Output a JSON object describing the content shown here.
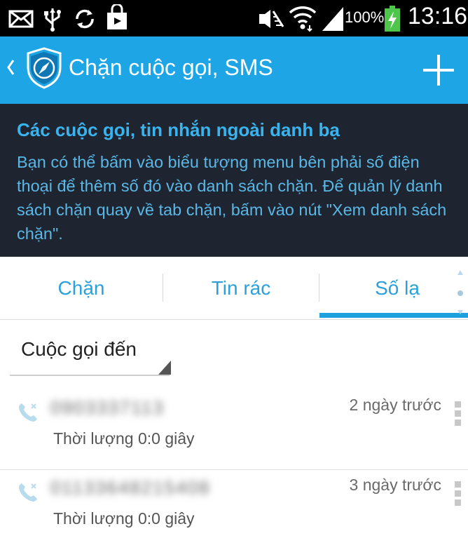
{
  "status_bar": {
    "battery": "100%",
    "clock": "13:16",
    "icons": [
      "mail-icon",
      "usb-icon",
      "sync-icon",
      "shopping-bag-icon",
      "mute-icon",
      "wifi-icon",
      "signal-icon",
      "battery-charging-icon"
    ]
  },
  "action_bar": {
    "title": "Chặn cuộc gọi, SMS",
    "add_icon": "plus-icon",
    "logo_icon": "shield-compass-icon"
  },
  "info_banner": {
    "heading": "Các cuộc gọi, tin nhắn ngoài danh bạ",
    "body": "Bạn có thể bấm vào biểu tượng menu bên phải số điện thoại để thêm số đó vào danh sách chặn. Để quản lý danh sách chặn quay về tab chặn, bấm vào nút \"Xem danh sách chặn\"."
  },
  "tabs": [
    {
      "label": "Chặn",
      "selected": false
    },
    {
      "label": "Tin rác",
      "selected": false
    },
    {
      "label": "Số lạ",
      "selected": true
    }
  ],
  "filter": {
    "selected": "Cuộc gọi đến"
  },
  "calls": [
    {
      "number": "0903337113",
      "time_ago": "2 ngày trước",
      "duration": "Thời lượng 0:0 giây",
      "icon": "missed-call-icon"
    },
    {
      "number": "01133648215408",
      "time_ago": "3 ngày trước",
      "duration": "Thời lượng 0:0 giây",
      "icon": "missed-call-icon"
    }
  ],
  "colors": {
    "accent": "#1ea5e6",
    "banner_bg": "#1e2530",
    "banner_heading": "#3ab4ee",
    "tab_text": "#2aa0dc"
  }
}
